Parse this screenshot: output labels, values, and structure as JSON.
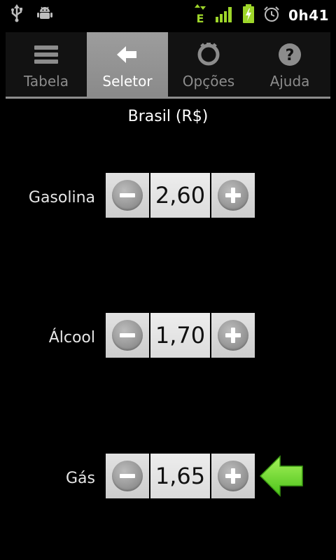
{
  "status_bar": {
    "time": "0h41",
    "network_type": "E",
    "icons": [
      "usb-icon",
      "android-debug-icon",
      "data-arrows-icon",
      "signal-icon",
      "battery-charging-icon",
      "alarm-icon"
    ]
  },
  "tabs": [
    {
      "label": "Tabela",
      "icon": "list-icon",
      "active": false
    },
    {
      "label": "Seletor",
      "icon": "arrow-left-icon",
      "active": true
    },
    {
      "label": "Opções",
      "icon": "options-icon",
      "active": false
    },
    {
      "label": "Ajuda",
      "icon": "help-icon",
      "active": false
    }
  ],
  "region_title": "Brasil (R$)",
  "fuels": [
    {
      "label": "Gasolina",
      "value": "2,60"
    },
    {
      "label": "Álcool",
      "value": "1,70"
    },
    {
      "label": "Gás",
      "value": "1,65"
    }
  ],
  "colors": {
    "background": "#000000",
    "active_tab": "#9a9a9a",
    "arrow": "#77e03a",
    "signal": "#9ed62a"
  }
}
